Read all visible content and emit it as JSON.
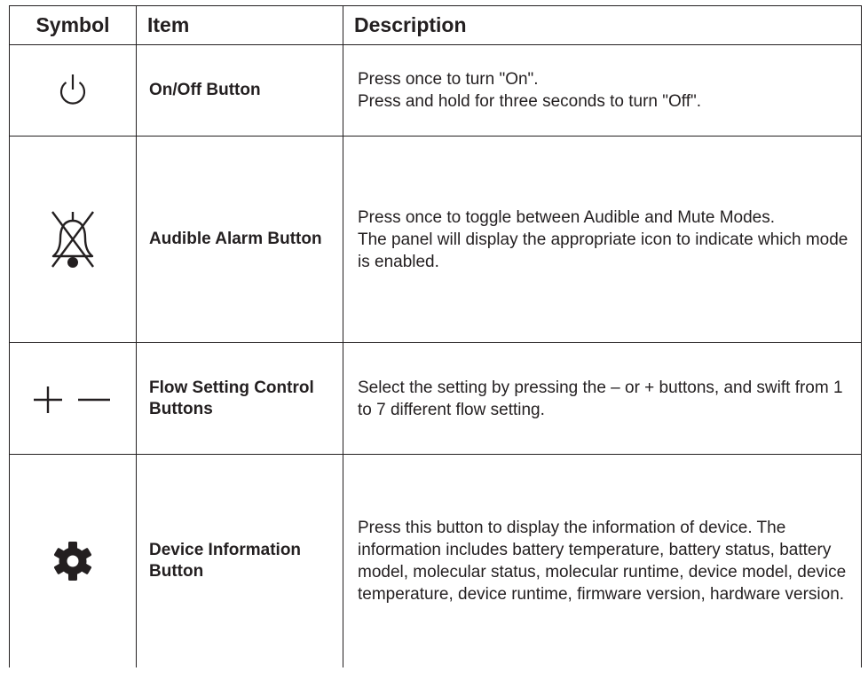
{
  "table": {
    "headers": {
      "symbol": "Symbol",
      "item": "Item",
      "description": "Description"
    },
    "rows": [
      {
        "icon": "power-icon",
        "item": "On/Off Button",
        "description": [
          "Press once to turn \"On\".",
          "Press and hold for three seconds to turn \"Off\"."
        ]
      },
      {
        "icon": "alarm-off-icon",
        "item": "Audible Alarm Button",
        "description": [
          "Press once to toggle between Audible and Mute Modes.",
          "The panel will display the appropriate icon to indicate which mode is enabled."
        ]
      },
      {
        "icon": "plus-minus-icon",
        "item": "Flow Setting Control Buttons",
        "description": [
          "Select the setting by pressing the – or + buttons, and swift from 1 to 7 different flow setting."
        ]
      },
      {
        "icon": "gear-icon",
        "item": "Device Information Button",
        "description": [
          "Press this button to display the information of device. The information includes battery temperature, battery status, battery model, molecular status, molecular runtime, device model, device temperature, device runtime, firmware version, hardware version."
        ]
      }
    ]
  }
}
